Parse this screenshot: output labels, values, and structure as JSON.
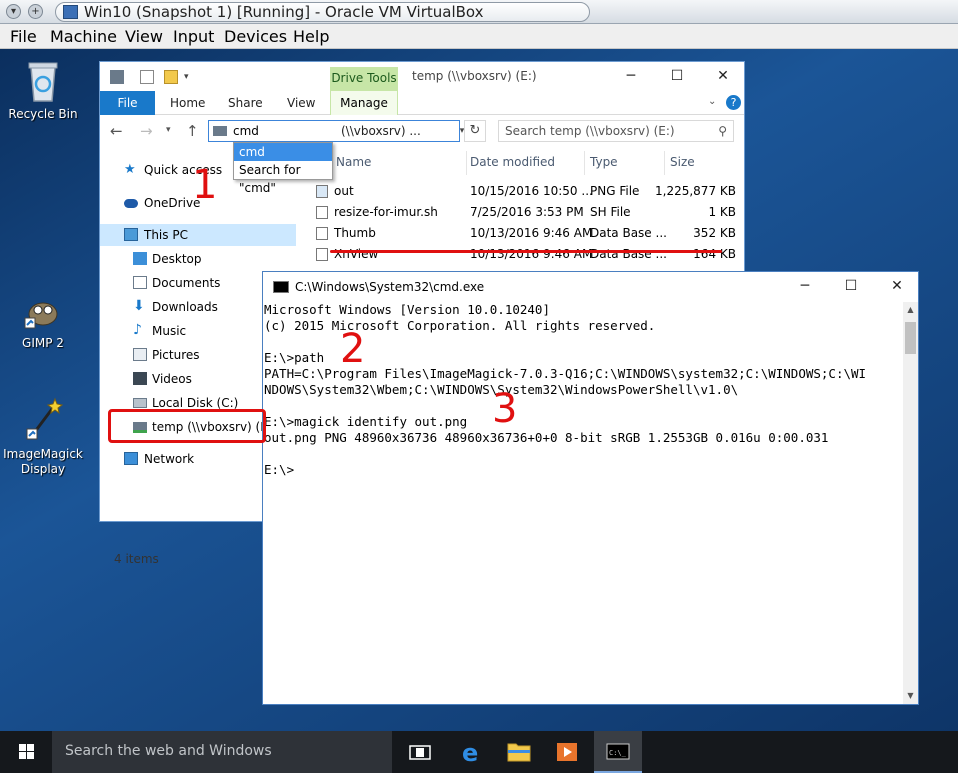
{
  "vbox": {
    "title": "Win10 (Snapshot 1) [Running] - Oracle VM VirtualBox",
    "menu": [
      "File",
      "Machine",
      "View",
      "Input",
      "Devices",
      "Help"
    ]
  },
  "desktop": {
    "icons": [
      {
        "label": "Recycle Bin",
        "icon": "recycle-bin-icon"
      },
      {
        "label": "GIMP 2",
        "icon": "gimp-icon"
      },
      {
        "label": "ImageMagick Display",
        "icon": "imagemagick-icon"
      }
    ]
  },
  "explorer": {
    "title": "temp (\\\\vboxsrv) (E:)",
    "drive_tools": "Drive Tools",
    "tabs": [
      "File",
      "Home",
      "Share",
      "View",
      "Manage"
    ],
    "address_value": "cmd",
    "address_rest": "(\\\\vboxsrv) ...",
    "search_placeholder": "Search temp (\\\\vboxsrv) (E:)",
    "autocomplete": [
      "cmd",
      "Search for \"cmd\""
    ],
    "nav": [
      "Quick access",
      "OneDrive",
      "This PC",
      "Desktop",
      "Documents",
      "Downloads",
      "Music",
      "Pictures",
      "Videos",
      "Local Disk (C:)",
      "temp (\\\\vboxsrv) (E:)",
      "Network"
    ],
    "columns": {
      "name": "Name",
      "date": "Date modified",
      "type": "Type",
      "size": "Size"
    },
    "files": [
      {
        "name": "out",
        "date": "10/15/2016 10:50 ...",
        "type": "PNG File",
        "size": "1,225,877 KB"
      },
      {
        "name": "resize-for-imur.sh",
        "date": "7/25/2016 3:53 PM",
        "type": "SH File",
        "size": "1 KB"
      },
      {
        "name": "Thumb",
        "date": "10/13/2016 9:46 AM",
        "type": "Data Base ...",
        "size": "352 KB"
      },
      {
        "name": "XnView",
        "date": "10/13/2016 9:46 AM",
        "type": "Data Base ...",
        "size": "164 KB"
      }
    ],
    "status": "4 items"
  },
  "cmd": {
    "title": "C:\\Windows\\System32\\cmd.exe",
    "lines": [
      "Microsoft Windows [Version 10.0.10240]",
      "(c) 2015 Microsoft Corporation. All rights reserved.",
      "",
      "E:\\>path",
      "PATH=C:\\Program Files\\ImageMagick-7.0.3-Q16;C:\\WINDOWS\\system32;C:\\WINDOWS;C:\\WI",
      "NDOWS\\System32\\Wbem;C:\\WINDOWS\\System32\\WindowsPowerShell\\v1.0\\",
      "",
      "E:\\>magick identify out.png",
      "out.png PNG 48960x36736 48960x36736+0+0 8-bit sRGB 1.2553GB 0.016u 0:00.031",
      "",
      "E:\\>"
    ]
  },
  "annotations": [
    "1",
    "2",
    "3"
  ],
  "taskbar": {
    "search": "Search the web and Windows"
  },
  "colors": {
    "accent": "#1979ca",
    "annotation": "#e01010",
    "selection": "#cce8ff"
  }
}
